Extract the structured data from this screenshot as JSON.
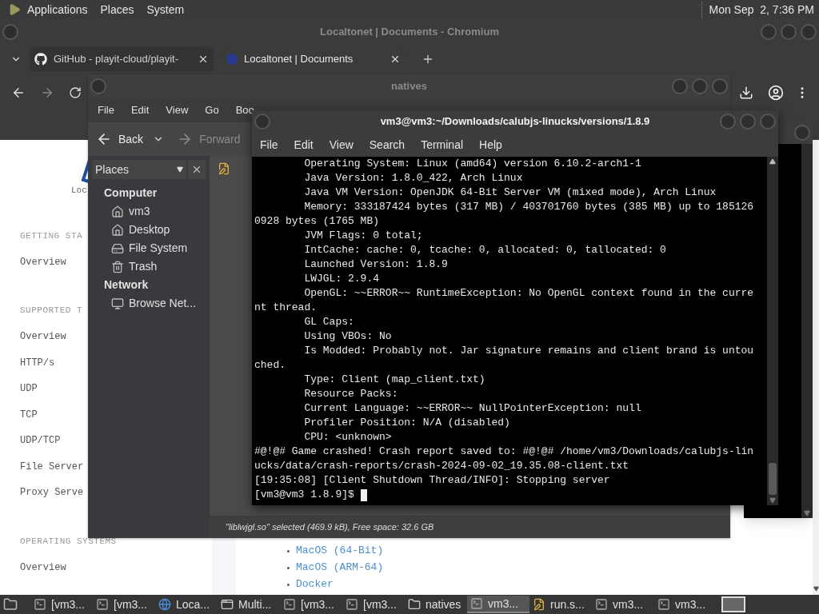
{
  "top_panel": {
    "menus": [
      "Applications",
      "Places",
      "System"
    ],
    "clock": "Mon Sep  2, 7:36 PM"
  },
  "browser": {
    "title": "Localtonet | Documents - Chromium",
    "tabs": [
      {
        "label": "GitHub - playit-cloud/playit-",
        "kind": "github",
        "selected": false
      },
      {
        "label": "Localtonet | Documents",
        "kind": "site",
        "selected": true
      }
    ],
    "sidebar": {
      "logo_text": "Loc",
      "sections": [
        {
          "heading": "GETTING STA",
          "items": [
            "Overview"
          ]
        },
        {
          "heading": "SUPPORTED T",
          "items": [
            "Overview",
            "HTTP/s",
            "UDP",
            "TCP",
            "UDP/TCP",
            "File Server",
            "Proxy Serve"
          ]
        },
        {
          "heading": "OPERATING SYSTEMS",
          "items": [
            "Overview"
          ]
        }
      ]
    },
    "content_links": [
      "MacOS (64-Bit)",
      "MacOS (ARM-64)",
      "Docker"
    ]
  },
  "file_manager": {
    "title": "natives",
    "menus": [
      "File",
      "Edit",
      "View",
      "Go",
      "Boo"
    ],
    "toolbar": {
      "back": "Back",
      "forward": "Forward",
      "forward_disabled": true
    },
    "pane_title": "Places",
    "places": [
      {
        "heading": "Computer",
        "items": [
          {
            "label": "vm3",
            "kind": "home"
          },
          {
            "label": "Desktop",
            "kind": "home"
          },
          {
            "label": "File System",
            "kind": "drive"
          },
          {
            "label": "Trash",
            "kind": "trash"
          }
        ]
      },
      {
        "heading": "Network",
        "items": [
          {
            "label": "Browse Net...",
            "kind": "network"
          }
        ]
      }
    ],
    "status": "\"liblwjgl.so\" selected (469.9 kB), Free space: 32.6 GB"
  },
  "terminal": {
    "title": "vm3@vm3:~/Downloads/calubjs-linucks/versions/1.8.9",
    "menus": [
      "File",
      "Edit",
      "View",
      "Search",
      "Terminal",
      "Help"
    ],
    "lines": [
      "        Operating System: Linux (amd64) version 6.10.2-arch1-1",
      "        Java Version: 1.8.0_422, Arch Linux",
      "        Java VM Version: OpenJDK 64-Bit Server VM (mixed mode), Arch Linux",
      "        Memory: 333187424 bytes (317 MB) / 403701760 bytes (385 MB) up to 185126",
      "0928 bytes (1765 MB)",
      "        JVM Flags: 0 total;",
      "        IntCache: cache: 0, tcache: 0, allocated: 0, tallocated: 0",
      "        Launched Version: 1.8.9",
      "        LWJGL: 2.9.4",
      "        OpenGL: ~~ERROR~~ RuntimeException: No OpenGL context found in the curre",
      "nt thread.",
      "        GL Caps:",
      "        Using VBOs: No",
      "        Is Modded: Probably not. Jar signature remains and client brand is untou",
      "ched.",
      "        Type: Client (map_client.txt)",
      "        Resource Packs:",
      "        Current Language: ~~ERROR~~ NullPointerException: null",
      "        Profiler Position: N/A (disabled)",
      "        CPU: <unknown>",
      "#@!@# Game crashed! Crash report saved to: #@!@# /home/vm3/Downloads/calubjs-lin",
      "ucks/data/crash-reports/crash-2024-09-02_19.35.08-client.txt",
      "[19:35:08] [Client Shutdown Thread/INFO]: Stopping server"
    ],
    "prompt": "[vm3@vm3 1.8.9]$ "
  },
  "taskbar": [
    {
      "label": "[vm3...",
      "kind": "terminal",
      "selected": false
    },
    {
      "label": "[vm3...",
      "kind": "terminal",
      "selected": false
    },
    {
      "label": "Loca...",
      "kind": "browser",
      "selected": false
    },
    {
      "label": "Multi...",
      "kind": "window",
      "selected": false
    },
    {
      "label": "[vm3...",
      "kind": "terminal",
      "selected": false
    },
    {
      "label": "[vm3...",
      "kind": "terminal",
      "selected": false
    },
    {
      "label": "natives",
      "kind": "folder",
      "selected": false
    },
    {
      "label": "vm3...",
      "kind": "terminal",
      "selected": true
    },
    {
      "label": "run.s...",
      "kind": "editor",
      "selected": false
    },
    {
      "label": "vm3...",
      "kind": "terminal",
      "selected": false
    },
    {
      "label": "vm3...",
      "kind": "terminal",
      "selected": false
    }
  ]
}
